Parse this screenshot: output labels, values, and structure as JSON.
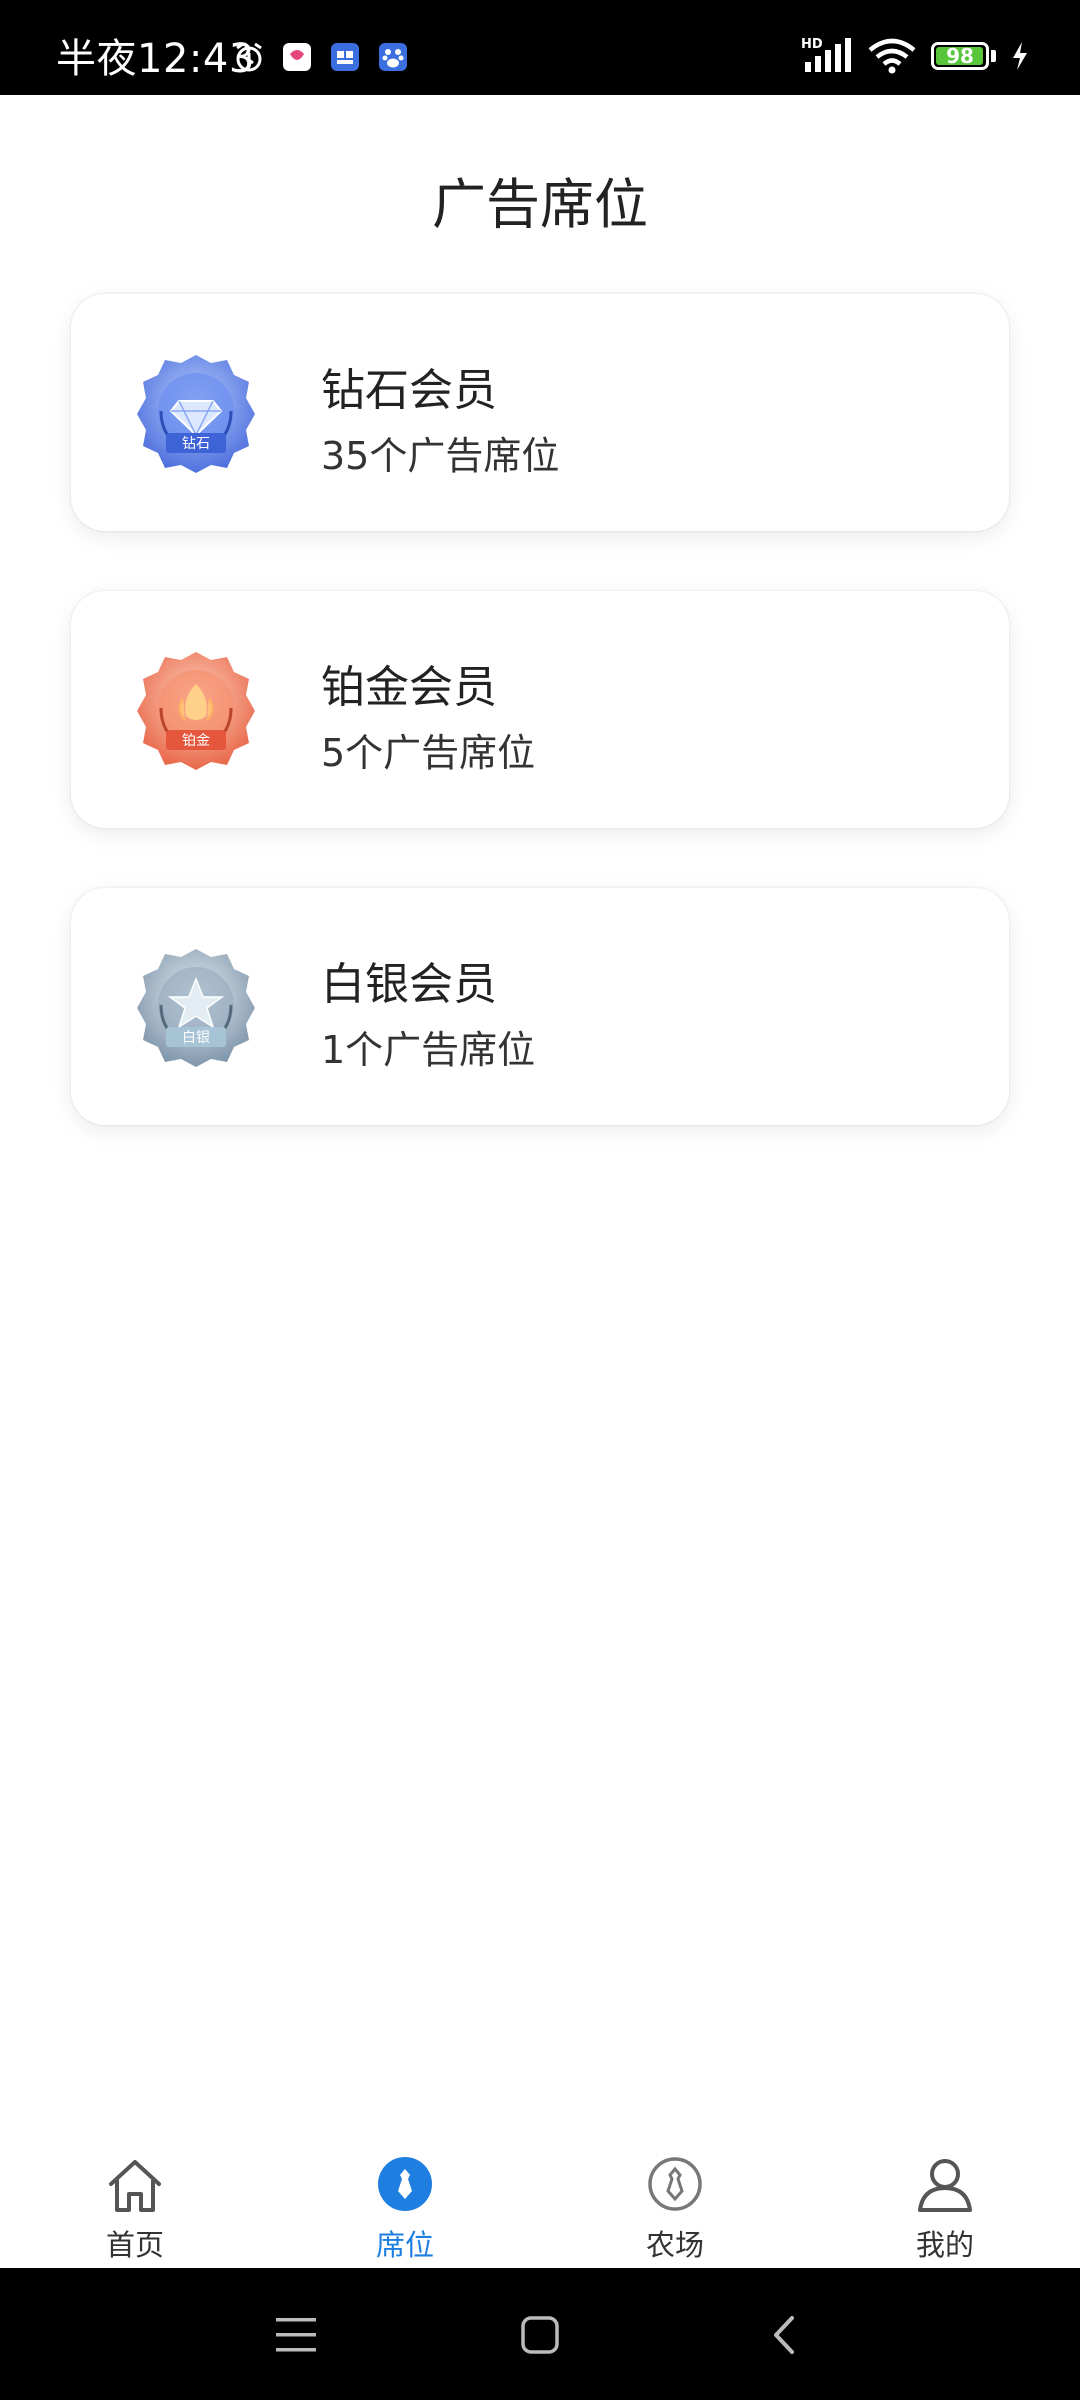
{
  "status_bar": {
    "time": "半夜12:43",
    "battery_level": "98",
    "network": "HD"
  },
  "page": {
    "title": "广告席位"
  },
  "cards": [
    {
      "title": "钻石会员",
      "subtitle": "35个广告席位",
      "badge_text": "钻石",
      "badge_color": "#4f7fe6"
    },
    {
      "title": "铂金会员",
      "subtitle": "5个广告席位",
      "badge_text": "铂金",
      "badge_color": "#ef7a5c"
    },
    {
      "title": "白银会员",
      "subtitle": "1个广告席位",
      "badge_text": "白银",
      "badge_color": "#8fa3b8"
    }
  ],
  "tabbar": {
    "items": [
      {
        "label": "首页",
        "icon": "home-icon",
        "active": false
      },
      {
        "label": "席位",
        "icon": "seat-icon",
        "active": true
      },
      {
        "label": "农场",
        "icon": "farm-icon",
        "active": false
      },
      {
        "label": "我的",
        "icon": "profile-icon",
        "active": false
      }
    ],
    "active_color": "#1e7fe0",
    "inactive_color": "#555555"
  },
  "nav_bar": {
    "buttons": [
      "menu-icon",
      "home-button-icon",
      "back-icon"
    ]
  }
}
